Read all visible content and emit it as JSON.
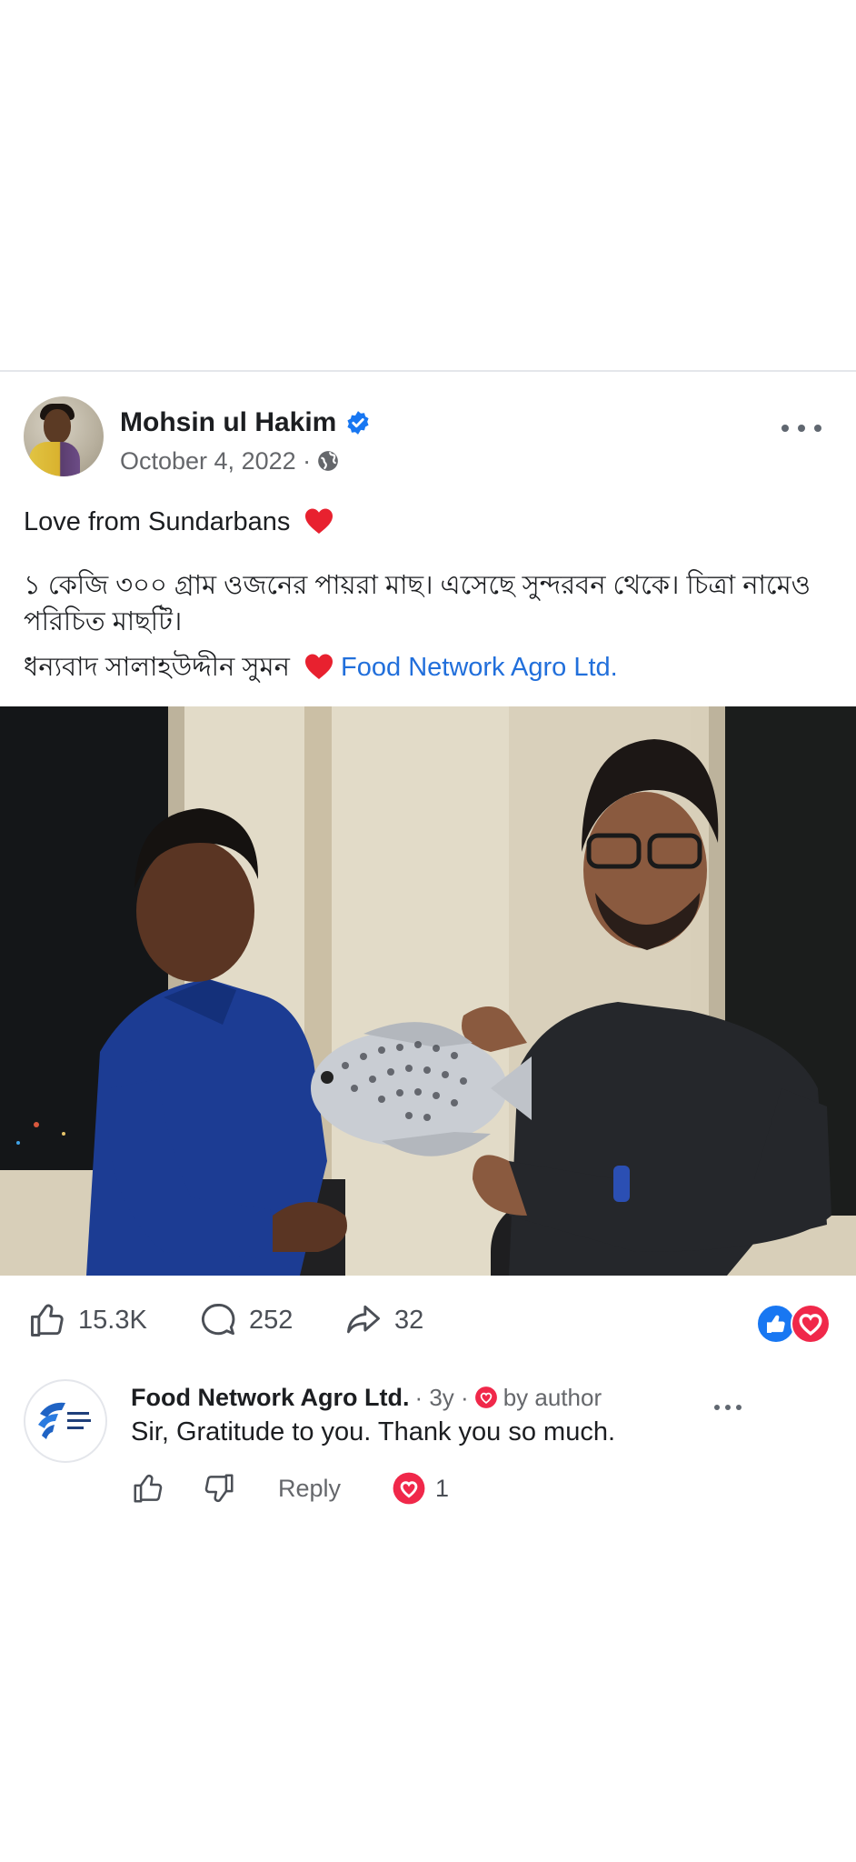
{
  "post": {
    "author": "Mohsin ul Hakim",
    "date": "October 4, 2022 ·",
    "line1": "Love from Sundarbans",
    "line2": "১ কেজি ৩০০ গ্রাম ওজনের পায়রা মাছ। এসেছে সুন্দরবন থেকে। চিত্রা নামেও পরিচিত মাছটি।",
    "line3": "ধন্যবাদ সালাহউদ্দীন সুমন",
    "tagged_page": "Food Network Agro Ltd."
  },
  "stats": {
    "likes": "15.3K",
    "comments": "252",
    "shares": "32"
  },
  "comment": {
    "author": "Food Network Agro Ltd.",
    "meta": "· 3y ·",
    "badge": "by author",
    "text": "Sir, Gratitude to you. Thank you so much.",
    "reply_label": "Reply",
    "love_count": "1"
  },
  "colors": {
    "link": "#216fdb",
    "like_blue": "#1877f2",
    "love_red": "#f0284a"
  }
}
